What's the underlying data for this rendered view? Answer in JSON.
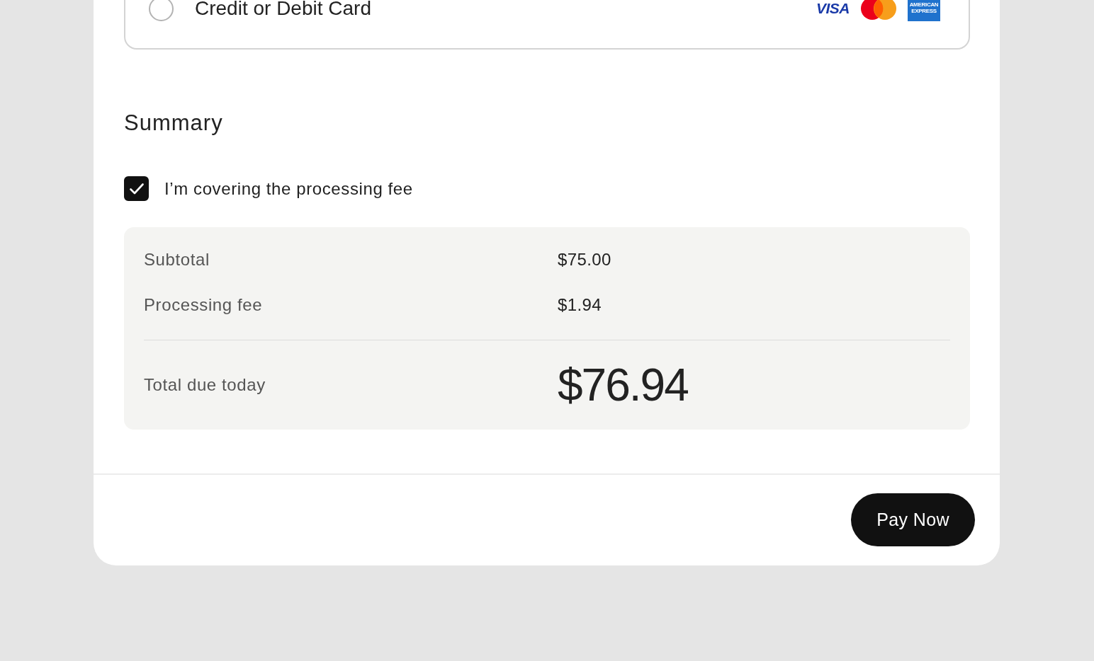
{
  "payment_method": {
    "label": "Credit or Debit Card",
    "selected": false,
    "card_brands": [
      {
        "kind": "visa",
        "text": "VISA"
      },
      {
        "kind": "mastercard"
      },
      {
        "kind": "amex",
        "text": "AMERICAN EXPRESS"
      }
    ]
  },
  "summary": {
    "title": "Summary",
    "cover_fee": {
      "label": "I’m covering the processing fee",
      "checked": true
    },
    "line_items": [
      {
        "label": "Subtotal",
        "value": "$75.00"
      },
      {
        "label": "Processing fee",
        "value": "$1.94"
      }
    ],
    "total": {
      "label": "Total due today",
      "value": "$76.94"
    }
  },
  "actions": [
    {
      "label": "Pay Now"
    }
  ]
}
